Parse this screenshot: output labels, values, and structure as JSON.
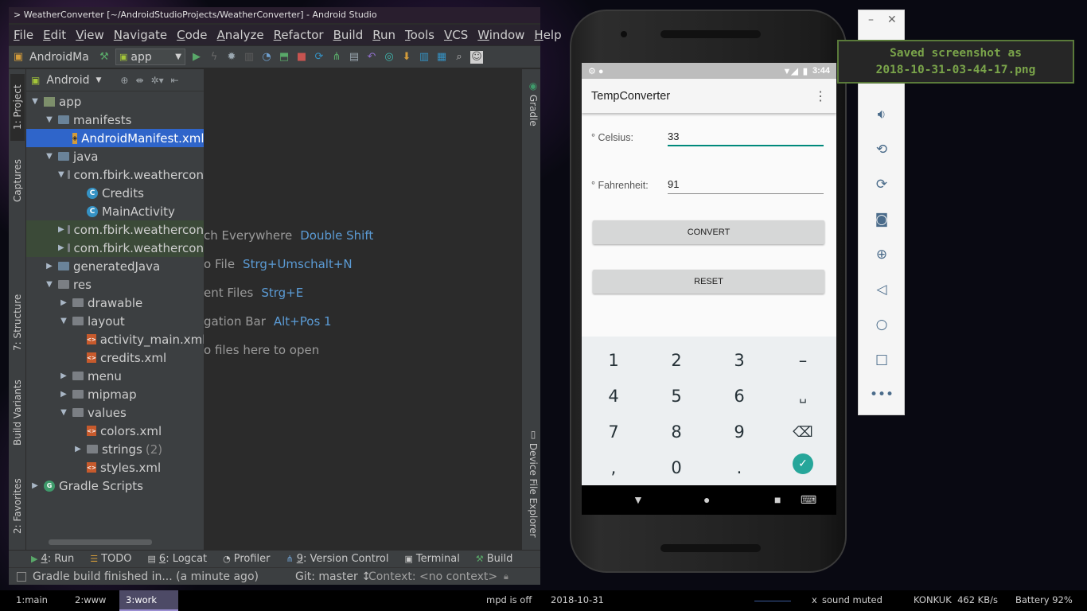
{
  "as_window": {
    "title": "> WeatherConverter [~/AndroidStudioProjects/WeatherConverter] - Android Studio",
    "menu": [
      "File",
      "Edit",
      "View",
      "Navigate",
      "Code",
      "Analyze",
      "Refactor",
      "Build",
      "Run",
      "Tools",
      "VCS",
      "Window",
      "Help"
    ],
    "toolbar": {
      "project_name": "AndroidMa",
      "run_config": "app"
    },
    "left_tabs": [
      "1: Project",
      "Captures",
      "7: Structure",
      "Build Variants",
      "2: Favorites"
    ],
    "right_tabs": [
      "Gradle",
      "Device File Explorer"
    ],
    "project_view": "Android",
    "tree": [
      {
        "label": "app",
        "muted": ""
      },
      {
        "label": "manifests",
        "muted": ""
      },
      {
        "label": "AndroidManifest.xml",
        "muted": ""
      },
      {
        "label": "java",
        "muted": ""
      },
      {
        "label": "com.fbirk.weathercon",
        "muted": ""
      },
      {
        "label": "Credits",
        "muted": ""
      },
      {
        "label": "MainActivity",
        "muted": ""
      },
      {
        "label": "com.fbirk.weathercon",
        "muted": ""
      },
      {
        "label": "com.fbirk.weathercon",
        "muted": ""
      },
      {
        "label": "generatedJava",
        "muted": ""
      },
      {
        "label": "res",
        "muted": ""
      },
      {
        "label": "drawable",
        "muted": ""
      },
      {
        "label": "layout",
        "muted": ""
      },
      {
        "label": "activity_main.xml",
        "muted": ""
      },
      {
        "label": "credits.xml",
        "muted": ""
      },
      {
        "label": "menu",
        "muted": ""
      },
      {
        "label": "mipmap",
        "muted": ""
      },
      {
        "label": "values",
        "muted": ""
      },
      {
        "label": "colors.xml",
        "muted": ""
      },
      {
        "label": "strings",
        "muted": "(2)"
      },
      {
        "label": "styles.xml",
        "muted": ""
      },
      {
        "label": "Gradle Scripts",
        "muted": ""
      }
    ],
    "editor_hints": [
      {
        "text": "ch Everywhere",
        "key": "Double Shift"
      },
      {
        "text": "o File",
        "key": "Strg+Umschalt+N"
      },
      {
        "text": "ent Files",
        "key": "Strg+E"
      },
      {
        "text": "gation Bar",
        "key": "Alt+Pos 1"
      },
      {
        "text": "o files here to open",
        "key": ""
      }
    ],
    "bottom_tools": [
      {
        "num": "4",
        "label": ": Run"
      },
      {
        "num": "",
        "label": "TODO"
      },
      {
        "num": "6",
        "label": ": Logcat"
      },
      {
        "num": "",
        "label": "Profiler"
      },
      {
        "num": "9",
        "label": ": Version Control"
      },
      {
        "num": "",
        "label": "Terminal"
      },
      {
        "num": "",
        "label": "Build"
      }
    ],
    "status": {
      "message": "Gradle build finished in... (a minute ago)",
      "git": "Git: master ↕",
      "context": "Context: <no context>"
    }
  },
  "emulator": {
    "status_time": "3:44",
    "app_title": "TempConverter",
    "celsius_label": "° Celsius:",
    "celsius_value": "33",
    "fahrenheit_label": "° Fahrenheit:",
    "fahrenheit_value": "91",
    "convert_label": "CONVERT",
    "reset_label": "RESET",
    "keys": [
      "1",
      "2",
      "3",
      "–",
      "4",
      "5",
      "6",
      "␣",
      "7",
      "8",
      "9",
      "⌫",
      ",",
      "0",
      ".",
      "✓"
    ]
  },
  "notification": {
    "line1": "Saved screenshot as",
    "line2": "2018-10-31-03-44-17.png"
  },
  "i3bar": {
    "workspaces": [
      "1:main",
      "2:www",
      "3:work"
    ],
    "mpd": "mpd is off",
    "date": "2018-10-31",
    "sound": "sound muted",
    "network": "KONKUK  462 KB/s",
    "battery": "Battery 92%"
  }
}
